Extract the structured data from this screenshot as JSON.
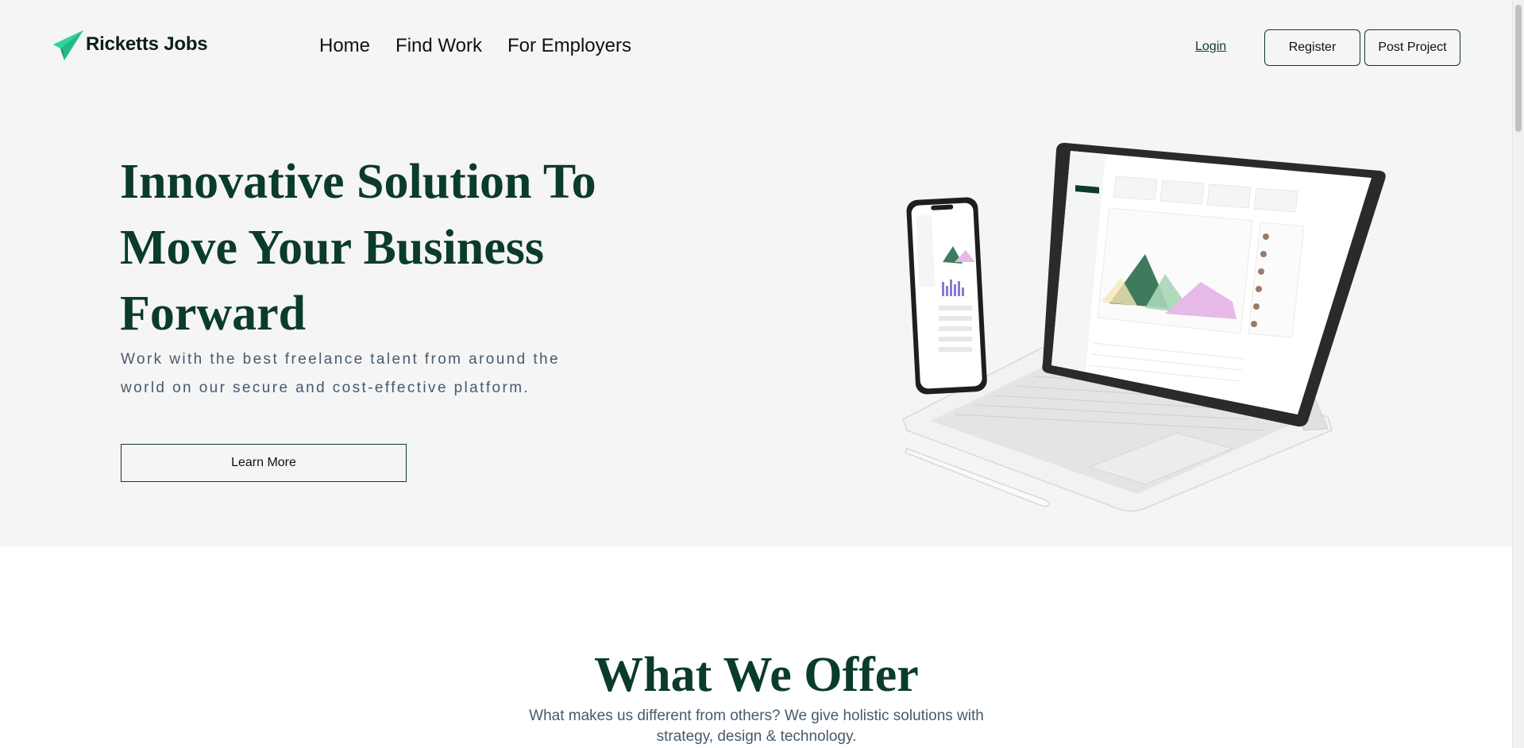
{
  "brand": {
    "name": "Ricketts Jobs",
    "icon": "paper-plane-icon",
    "accent": "#2fd39a"
  },
  "nav": {
    "items": [
      "Home",
      "Find Work",
      "For Employers"
    ]
  },
  "auth": {
    "login_label": "Login",
    "register_label": "Register",
    "post_project_label": "Post Project"
  },
  "hero": {
    "title": "Innovative Solution To Move Your Business Forward",
    "subtitle": "Work with the best freelance talent from around the world on our secure and cost-effective platform.",
    "cta_label": "Learn More"
  },
  "offer": {
    "title": "What We Offer",
    "subtitle": "What makes us different from others? We give holistic solutions with strategy, design & technology."
  },
  "colors": {
    "primary": "#0b3b2b",
    "text_muted": "#475a6b",
    "hero_bg": "#f5f5f5"
  }
}
